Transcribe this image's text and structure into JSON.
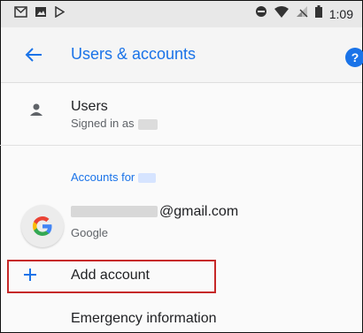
{
  "status_bar": {
    "time": "1:09",
    "left_icons": [
      "gmail-icon",
      "photo-icon",
      "play-store-icon"
    ],
    "right_icons": [
      "do-not-disturb-icon",
      "wifi-icon",
      "signal-icon",
      "battery-icon"
    ]
  },
  "app_bar": {
    "back_icon": "arrow-back-icon",
    "title": "Users & accounts",
    "help_icon": "help-icon",
    "help_glyph": "?",
    "accent_color": "#1a73e8"
  },
  "users": {
    "label": "Users",
    "subtitle": "Signed in as"
  },
  "accounts": {
    "section_title": "Accounts for",
    "items": [
      {
        "email_suffix": "@gmail.com",
        "provider": "Google",
        "icon": "google-icon"
      }
    ],
    "add_account_label": "Add account",
    "add_icon": "plus-icon"
  },
  "emergency": {
    "label": "Emergency information"
  }
}
